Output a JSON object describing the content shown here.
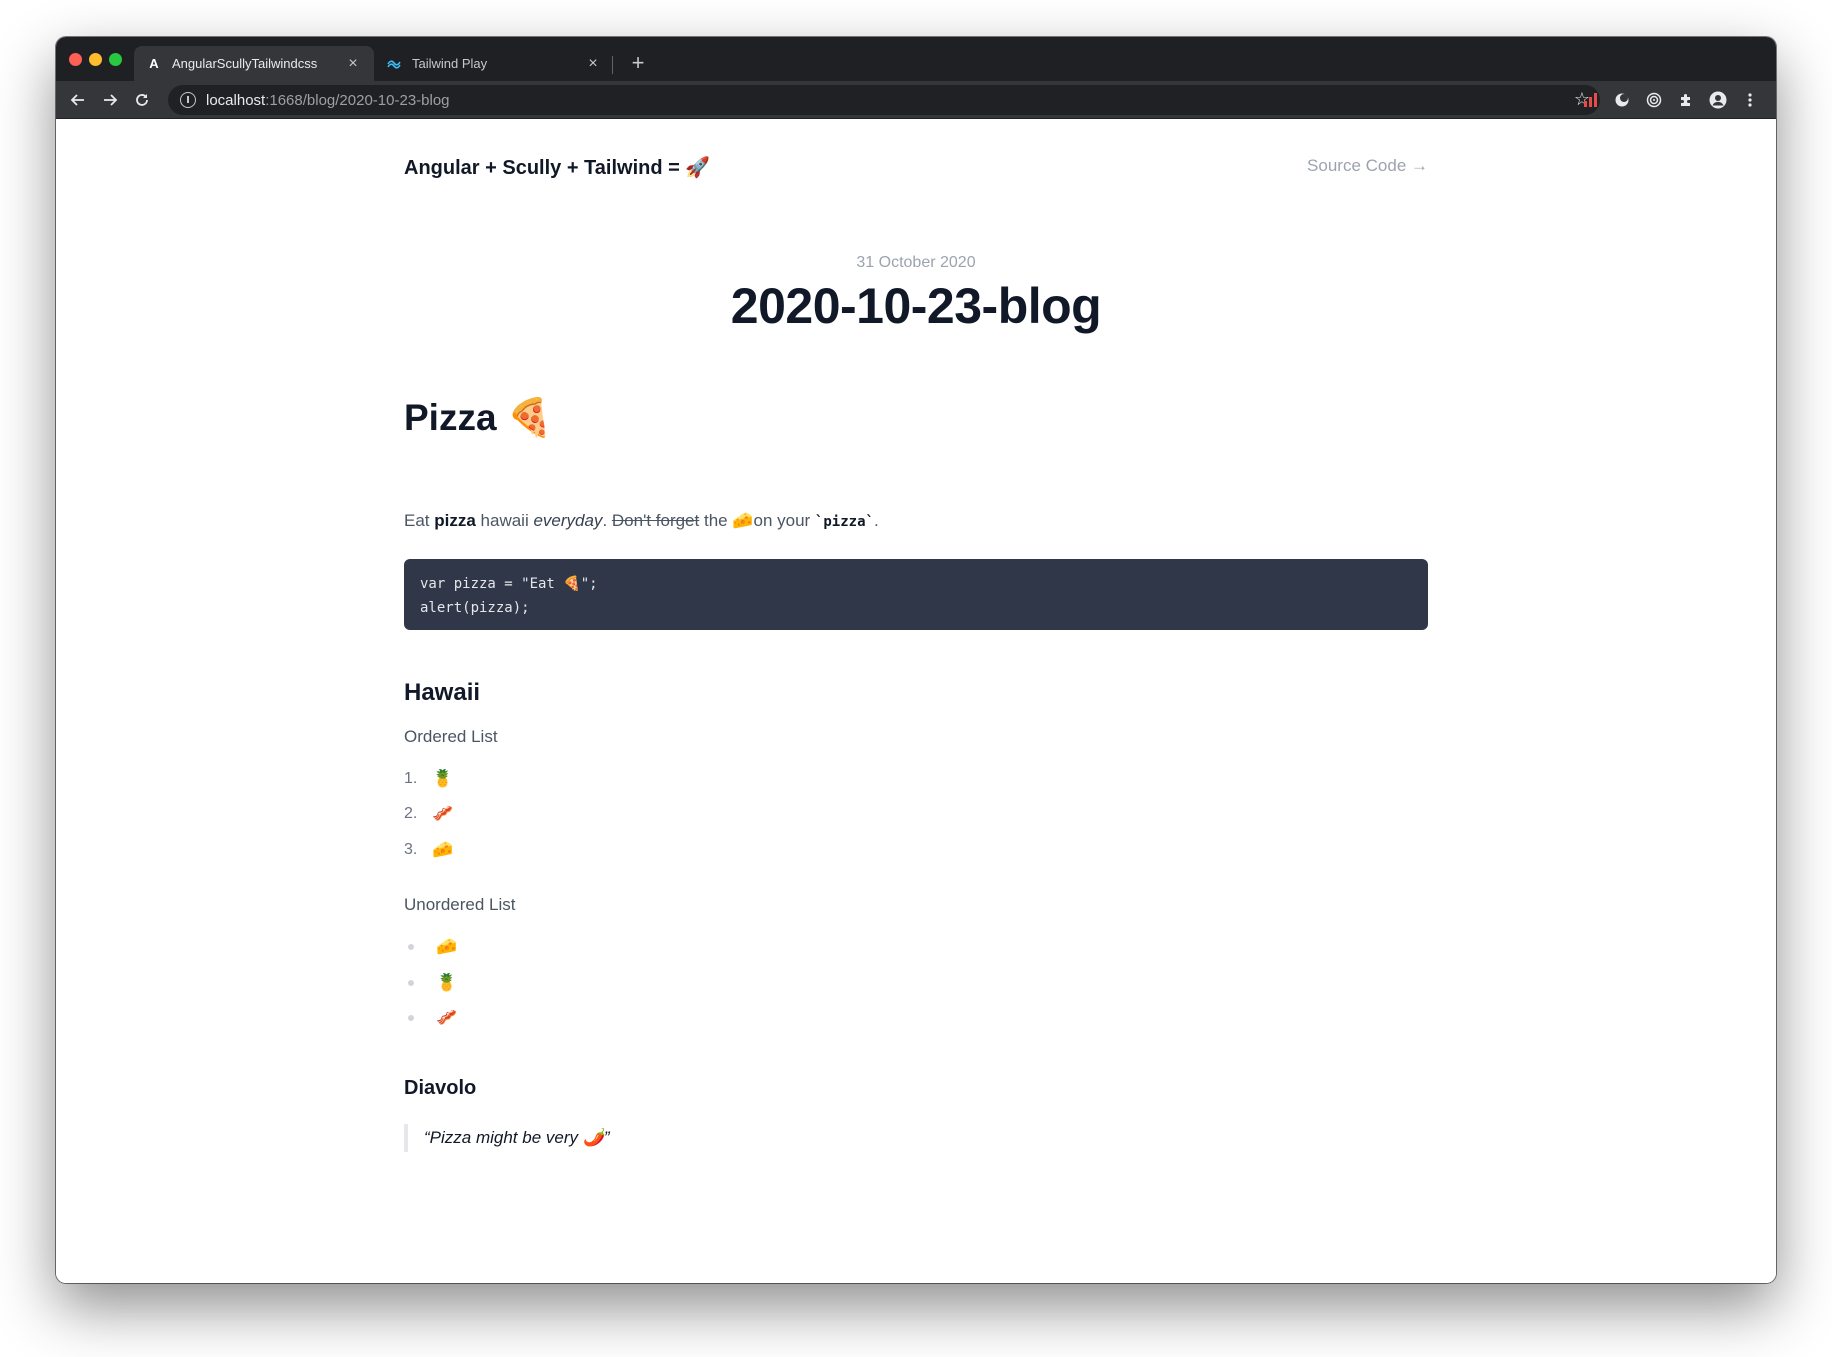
{
  "browser": {
    "tabs": [
      {
        "label": "AngularScullyTailwindcss",
        "favicon": "A"
      },
      {
        "label": "Tailwind Play",
        "favicon": "~"
      }
    ],
    "url_host": "localhost",
    "url_path": ":1668/blog/2020-10-23-blog"
  },
  "site": {
    "title": "Angular + Scully + Tailwind = 🚀",
    "source_link": "Source Code →"
  },
  "post": {
    "date": "31 October 2020",
    "title": "2020-10-23-blog",
    "h1": "Pizza 🍕",
    "para": {
      "t1": "Eat ",
      "bold": "pizza",
      "t2": " hawaii ",
      "italic": "everyday",
      "t3": ". ",
      "strike": "Don't forget",
      "t4": " the 🧀on your ",
      "code": "`pizza`",
      "t5": "."
    },
    "code_lines": [
      "var pizza = \"Eat 🍕\";",
      "alert(pizza);"
    ],
    "h2": "Hawaii",
    "ordered_label": "Ordered List",
    "ordered": [
      {
        "num": "1.",
        "emoji": "🍍"
      },
      {
        "num": "2.",
        "emoji": "🥓"
      },
      {
        "num": "3.",
        "emoji": "🧀"
      }
    ],
    "unordered_label": "Unordered List",
    "unordered": [
      {
        "emoji": "🧀"
      },
      {
        "emoji": "🍍"
      },
      {
        "emoji": "🥓"
      }
    ],
    "h3": "Diavolo",
    "quote": "“Pizza might be very 🌶️”"
  }
}
